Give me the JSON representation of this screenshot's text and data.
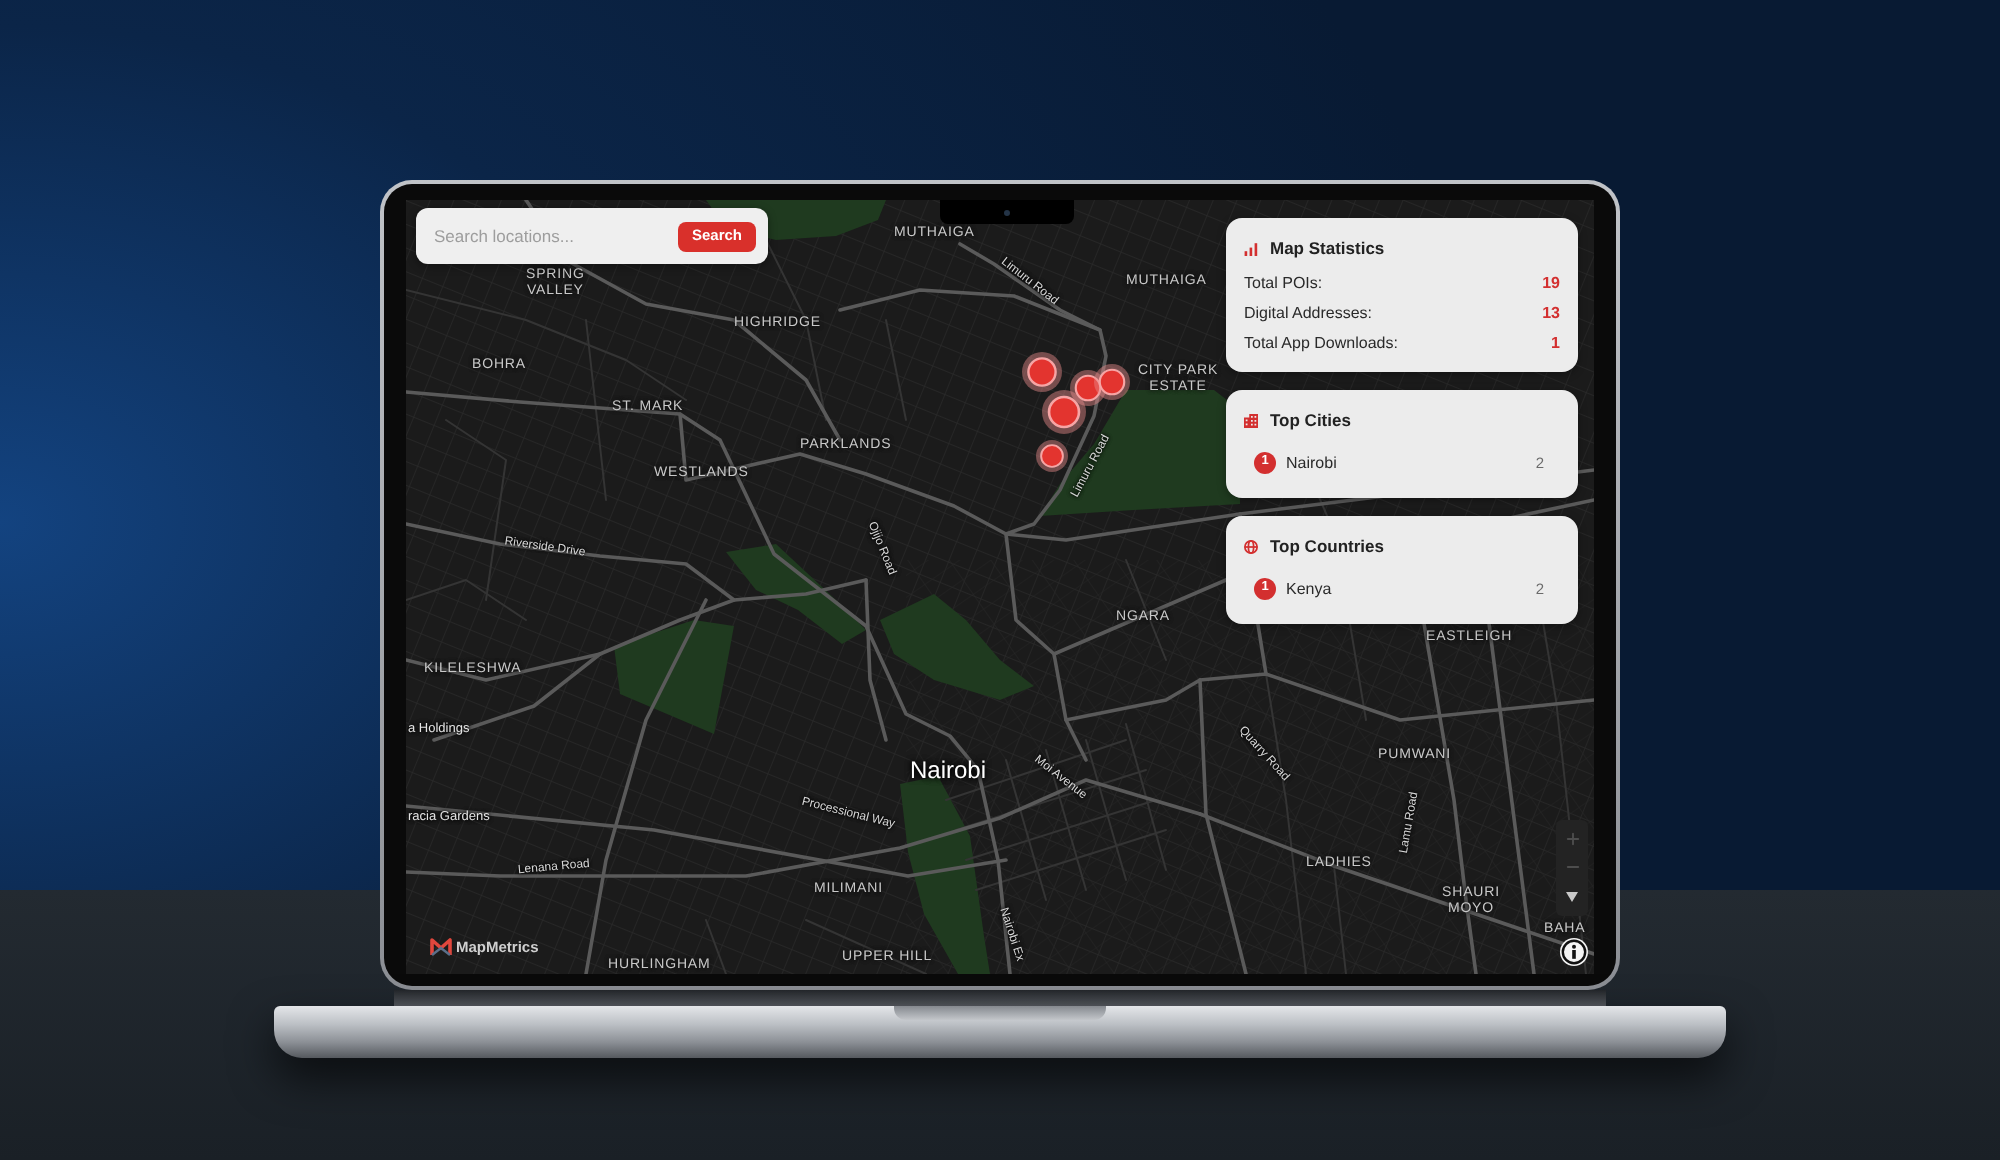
{
  "search": {
    "placeholder": "Search locations...",
    "button": "Search"
  },
  "map": {
    "labels": [
      {
        "text": "MUTHAIGA",
        "kind": "area"
      },
      {
        "text": "MUTHAIGA",
        "kind": "area"
      },
      {
        "text": "SPRING VALLEY",
        "kind": "area"
      },
      {
        "text": "HIGHRIDGE",
        "kind": "area"
      },
      {
        "text": "BOHRA",
        "kind": "area"
      },
      {
        "text": "ST. MARK",
        "kind": "area"
      },
      {
        "text": "PARKLANDS",
        "kind": "area"
      },
      {
        "text": "WESTLANDS",
        "kind": "area"
      },
      {
        "text": "Riverside Drive",
        "kind": "road"
      },
      {
        "text": "Ojijo Road",
        "kind": "road"
      },
      {
        "text": "Limuru Road",
        "kind": "road"
      },
      {
        "text": "Limuru Road",
        "kind": "road"
      },
      {
        "text": "CITY PARK ESTATE",
        "kind": "area"
      },
      {
        "text": "NGARA",
        "kind": "area"
      },
      {
        "text": "KILELESHWA",
        "kind": "area"
      },
      {
        "text": "a Holdings",
        "kind": "poi"
      },
      {
        "text": "racia Gardens",
        "kind": "poi"
      },
      {
        "text": "Nairobi",
        "kind": "city"
      },
      {
        "text": "Moi Avenue",
        "kind": "road"
      },
      {
        "text": "Processional Way",
        "kind": "road"
      },
      {
        "text": "Lenana Road",
        "kind": "road"
      },
      {
        "text": "MILIMANI",
        "kind": "area"
      },
      {
        "text": "UPPER HILL",
        "kind": "area"
      },
      {
        "text": "HURLINGHAM",
        "kind": "area"
      },
      {
        "text": "Nairobi Ex",
        "kind": "road"
      },
      {
        "text": "LADHIES",
        "kind": "area"
      },
      {
        "text": "SHAURI MOYO",
        "kind": "area"
      },
      {
        "text": "PUMWANI",
        "kind": "area"
      },
      {
        "text": "EASTLEIGH",
        "kind": "area"
      },
      {
        "text": "Quarry Road",
        "kind": "road"
      },
      {
        "text": "Lamu Road",
        "kind": "road"
      },
      {
        "text": "BAHA",
        "kind": "area"
      }
    ]
  },
  "statistics": {
    "title": "Map Statistics",
    "rows": [
      {
        "label": "Total POIs:",
        "value": "19"
      },
      {
        "label": "Digital Addresses:",
        "value": "13"
      },
      {
        "label": "Total App Downloads:",
        "value": "1"
      }
    ]
  },
  "top_cities": {
    "title": "Top Cities",
    "items": [
      {
        "rank": "1",
        "name": "Nairobi",
        "count": "2"
      }
    ]
  },
  "top_countries": {
    "title": "Top Countries",
    "items": [
      {
        "rank": "1",
        "name": "Kenya",
        "count": "2"
      }
    ]
  },
  "logo": {
    "text": "MapMetrics"
  }
}
